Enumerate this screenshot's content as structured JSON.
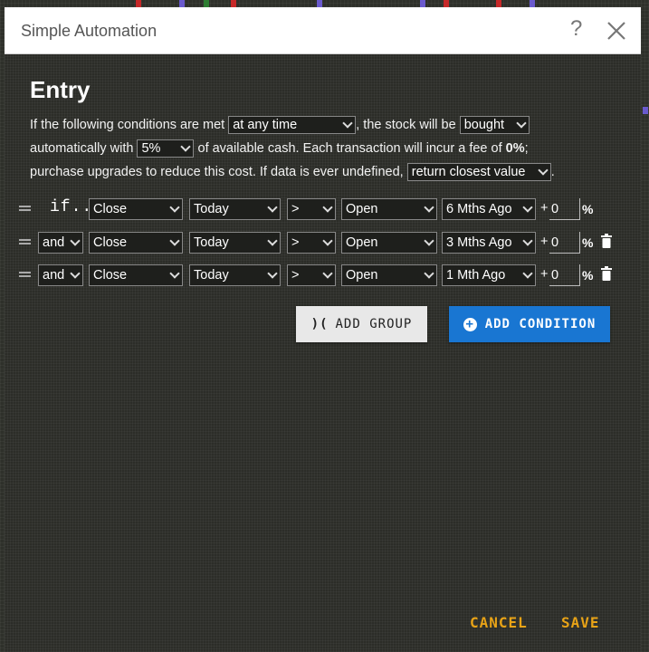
{
  "dialog": {
    "title": "Simple Automation",
    "help_glyph": "?",
    "heading": "Entry"
  },
  "sentence": {
    "p1": "If the following conditions are met",
    "when": "at any time",
    "p2": ", the stock will be",
    "action": "bought",
    "p3": "automatically with",
    "amount": "5%",
    "p4": "of available cash. Each transaction will incur a fee of",
    "fee": "0%",
    "p5": ";",
    "p6": "purchase upgrades to reduce this cost. If data is ever undefined,",
    "undefined": "return closest value",
    "p7": "."
  },
  "conditions": [
    {
      "connector": "if...",
      "field": "Close",
      "period": "Today",
      "op": ">",
      "cmp_field": "Open",
      "cmp_period": "6 Mths Ago",
      "plus": "+",
      "offset": "0",
      "pct": "%",
      "deletable": false
    },
    {
      "connector": "and",
      "field": "Close",
      "period": "Today",
      "op": ">",
      "cmp_field": "Open",
      "cmp_period": "3 Mths Ago",
      "plus": "+",
      "offset": "0",
      "pct": "%",
      "deletable": true
    },
    {
      "connector": "and",
      "field": "Close",
      "period": "Today",
      "op": ">",
      "cmp_field": "Open",
      "cmp_period": "1 Mth Ago",
      "plus": "+",
      "offset": "0",
      "pct": "%",
      "deletable": true
    }
  ],
  "buttons": {
    "add_group_icon": ")(",
    "add_group": "ADD GROUP",
    "add_condition_icon": "+",
    "add_condition": "ADD CONDITION",
    "cancel": "CANCEL",
    "save": "SAVE"
  },
  "colors": {
    "accent_blue": "#1976d2",
    "footer_orange": "#e8a317"
  }
}
